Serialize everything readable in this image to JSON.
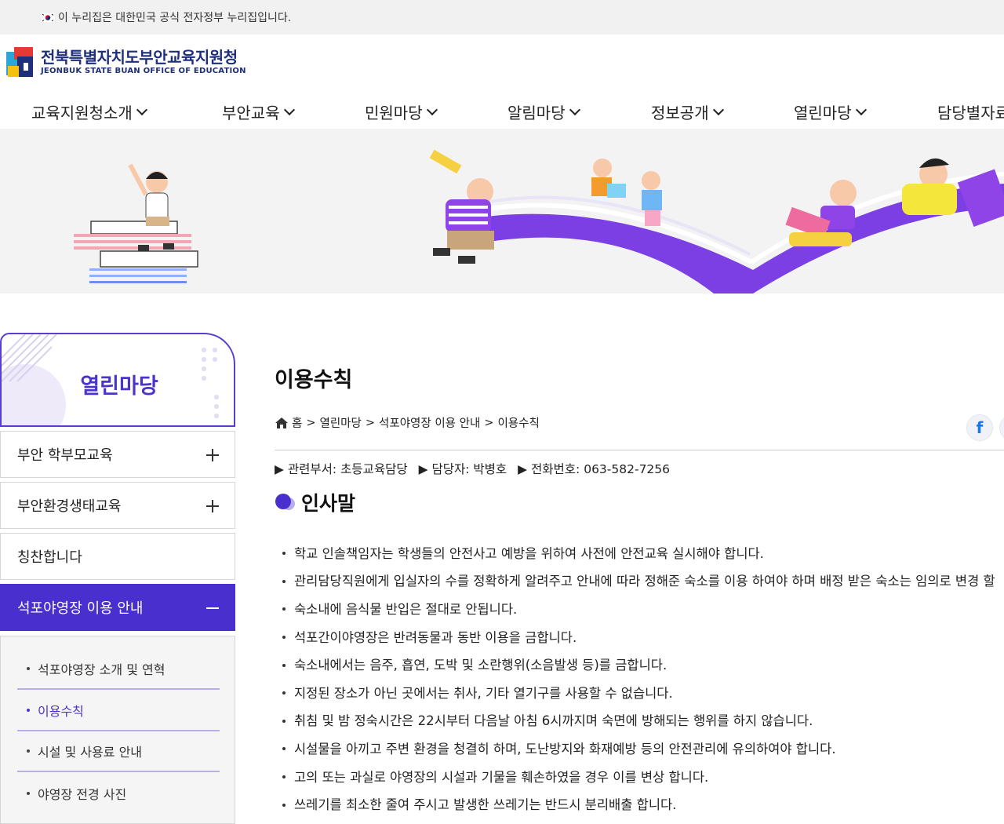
{
  "gov_banner": {
    "text": "이 누리집은 대한민국 공식 전자정부 누리집입니다."
  },
  "logo": {
    "name_ko": "전북특별자치도부안교육지원청",
    "name_en": "JEONBUK STATE BUAN OFFICE OF EDUCATION"
  },
  "gnb": {
    "items": [
      {
        "label": "교육지원청소개"
      },
      {
        "label": "부안교육"
      },
      {
        "label": "민원마당"
      },
      {
        "label": "알림마당"
      },
      {
        "label": "정보공개"
      },
      {
        "label": "열린마당"
      },
      {
        "label": "담당별자료"
      }
    ]
  },
  "sidebar": {
    "title": "열린마당",
    "items": [
      {
        "label": "부안 학부모교육",
        "expandable": true
      },
      {
        "label": "부안환경생태교육",
        "expandable": true
      },
      {
        "label": "칭찬합니다",
        "expandable": false
      },
      {
        "label": "석포야영장 이용 안내",
        "expandable": true,
        "active": true
      }
    ],
    "sub_items": [
      {
        "label": "석포야영장 소개 및 연혁"
      },
      {
        "label": "이용수칙",
        "active": true
      },
      {
        "label": "시설 및 사용료 안내"
      },
      {
        "label": "야영장 전경 사진"
      }
    ]
  },
  "content": {
    "page_title": "이용수칙",
    "breadcrumb": {
      "home": "홈",
      "sep": ">",
      "level1": "열린마당",
      "level2": "석포야영장 이용 안내",
      "level3": "이용수칙"
    },
    "share": {
      "facebook": "f"
    },
    "info": {
      "dept": "▶ 관련부서: 초등교육담당",
      "manager": "▶ 담당자: 박병호",
      "phone": "▶ 전화번호: 063-582-7256"
    },
    "section_title": "인사말",
    "rules": [
      "학교 인솔책임자는 학생들의 안전사고 예방을 위하여 사전에 안전교육 실시해야 합니다.",
      "관리담당직원에게 입실자의 수를 정확하게 알려주고 안내에 따라 정해준 숙소를 이용 하여야 하며 배정 받은 숙소는 임의로 변경 할",
      "숙소내에 음식물 반입은 절대로 안됩니다.",
      "석포간이야영장은 반려동물과 동반 이용을 금합니다.",
      "숙소내에서는 음주, 흡연, 도박 및 소란행위(소음발생 등)를 금합니다.",
      "지정된 장소가 아닌 곳에서는 취사, 기타 열기구를 사용할 수 없습니다.",
      "취침 및 밤 정숙시간은 22시부터 다음날 아침 6시까지며 숙면에 방해되는 행위를 하지 않습니다.",
      "시설물을 아끼고 주변 환경을 청결히 하며, 도난방지와 화재예방 등의 안전관리에 유의하여야 합니다.",
      "고의 또는 과실로 야영장의 시설과 기물을 훼손하였을 경우 이를 변상 합니다.",
      "쓰레기를 최소한 줄여 주시고 발생한 쓰레기는 반드시 분리배출 합니다."
    ]
  },
  "colors": {
    "accent": "#4a2fcf",
    "brand": "#1f2f7a",
    "hero_bg": "#f3f3f3"
  }
}
